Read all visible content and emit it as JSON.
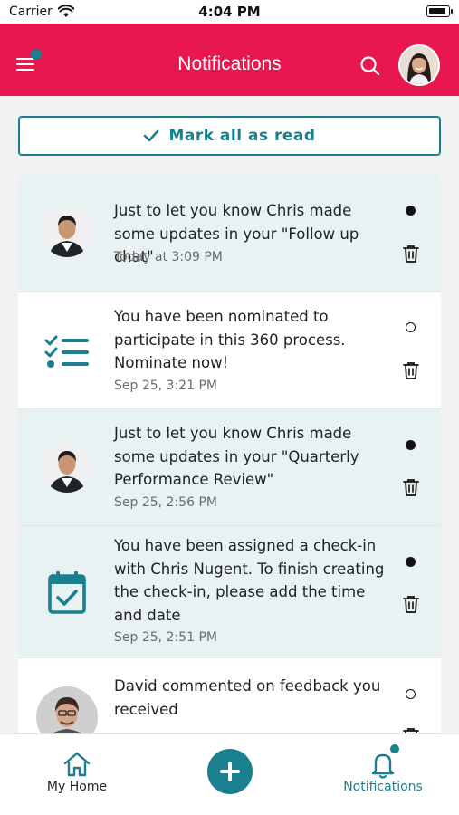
{
  "status_bar": {
    "carrier": "Carrier",
    "time": "4:04 PM"
  },
  "header": {
    "title": "Notifications"
  },
  "actions": {
    "mark_all": "Mark all as read"
  },
  "notifications": [
    {
      "text": "Just to let you know Chris made some updates in your \"Follow up chat\"",
      "time": "Today at 3:09 PM",
      "read": false,
      "icon": "person-avatar"
    },
    {
      "text": "You have been nominated to participate in this 360 process. Nominate now!",
      "time": "Sep 25, 3:21 PM",
      "read": true,
      "icon": "checklist-icon"
    },
    {
      "text": "Just to let you know Chris made some updates in your \"Quarterly Performance Review\"",
      "time": "Sep 25, 2:56 PM",
      "read": false,
      "icon": "person-avatar"
    },
    {
      "text": "You have been assigned a check-in with Chris Nugent. To finish creating the check-in, please add the time and date",
      "time": "Sep 25, 2:51 PM",
      "read": false,
      "icon": "calendar-check-icon"
    },
    {
      "text": "David commented on feedback you received",
      "time": "",
      "read": true,
      "icon": "person-avatar"
    }
  ],
  "tabs": {
    "home": "My Home",
    "notifications": "Notifications"
  },
  "colors": {
    "header": "#e8174f",
    "accent": "#1a7f8e",
    "unread_bg": "#e8f2f2"
  }
}
